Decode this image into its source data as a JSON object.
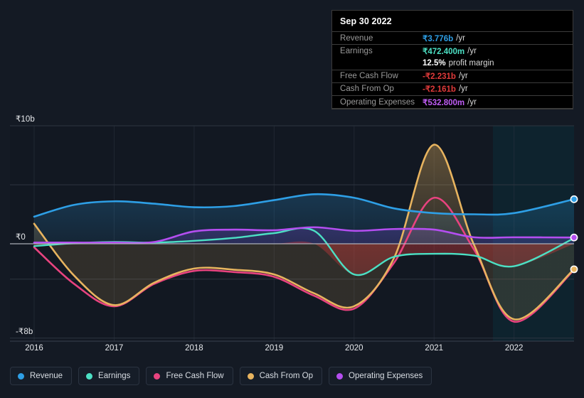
{
  "chart_data": {
    "type": "area",
    "title": "",
    "xlabel": "",
    "ylabel": "",
    "currency": "₹",
    "ylim": [
      -8,
      10
    ],
    "y_ticks": [
      {
        "label": "₹10b",
        "value": 10
      },
      {
        "label": "₹0",
        "value": 0
      },
      {
        "label": "-₹8b",
        "value": -8
      }
    ],
    "x_ticks": [
      "2016",
      "2017",
      "2018",
      "2019",
      "2020",
      "2021",
      "2022"
    ],
    "grid": true,
    "legend_position": "bottom",
    "forecast_band_start": "2022",
    "series": [
      {
        "name": "Revenue",
        "color": "#2e9fe6",
        "x": [
          2016.0,
          2016.5,
          2017.0,
          2017.5,
          2018.0,
          2018.5,
          2019.0,
          2019.5,
          2020.0,
          2020.5,
          2021.0,
          2021.5,
          2022.0,
          2022.75
        ],
        "values": [
          2.3,
          3.3,
          3.6,
          3.4,
          3.1,
          3.2,
          3.7,
          4.2,
          3.9,
          3.0,
          2.6,
          2.5,
          2.6,
          3.776
        ]
      },
      {
        "name": "Earnings",
        "color": "#4ce0c4",
        "x": [
          2016.0,
          2016.5,
          2017.0,
          2017.5,
          2018.0,
          2018.5,
          2019.0,
          2019.5,
          2020.0,
          2020.5,
          2021.0,
          2021.5,
          2022.0,
          2022.75
        ],
        "values": [
          -0.2,
          0.05,
          0.15,
          0.1,
          0.25,
          0.5,
          0.9,
          1.1,
          -2.6,
          -1.1,
          -0.85,
          -1.0,
          -1.9,
          0.4724
        ]
      },
      {
        "name": "Free Cash Flow",
        "color": "#e8437f",
        "x": [
          2016.0,
          2016.5,
          2017.0,
          2017.5,
          2018.0,
          2018.5,
          2019.0,
          2019.5,
          2020.0,
          2020.5,
          2021.0,
          2021.5,
          2022.0,
          2022.75
        ],
        "values": [
          -0.3,
          -3.4,
          -5.3,
          -3.4,
          -2.3,
          -2.4,
          -2.8,
          -4.4,
          -5.5,
          -1.6,
          3.9,
          -0.5,
          -6.6,
          -2.231
        ]
      },
      {
        "name": "Cash From Op",
        "color": "#e8b45f",
        "x": [
          2016.0,
          2016.5,
          2017.0,
          2017.5,
          2018.0,
          2018.5,
          2019.0,
          2019.5,
          2020.0,
          2020.5,
          2021.0,
          2021.5,
          2022.0,
          2022.75
        ],
        "values": [
          1.7,
          -2.7,
          -5.2,
          -3.3,
          -2.1,
          -2.2,
          -2.6,
          -4.2,
          -5.3,
          -1.2,
          8.4,
          -0.1,
          -6.4,
          -2.161
        ]
      },
      {
        "name": "Operating Expenses",
        "color": "#b44ef0",
        "x": [
          2016.0,
          2016.5,
          2017.0,
          2017.5,
          2018.0,
          2018.5,
          2019.0,
          2019.5,
          2020.0,
          2020.5,
          2021.0,
          2021.5,
          2022.0,
          2022.75
        ],
        "values": [
          0.1,
          0.1,
          0.1,
          0.15,
          1.05,
          1.2,
          1.15,
          1.4,
          1.1,
          1.25,
          1.2,
          0.55,
          0.55,
          0.5328
        ]
      }
    ]
  },
  "tooltip": {
    "date": "Sep 30 2022",
    "rows": [
      {
        "name": "Revenue",
        "value": "₹3.776b",
        "unit": "/yr",
        "color": "#2e9fe6"
      },
      {
        "name": "Earnings",
        "value": "₹472.400m",
        "unit": "/yr",
        "color": "#4ce0c4"
      },
      {
        "name": "Free Cash Flow",
        "value": "-₹2.231b",
        "unit": "/yr",
        "color": "#e03a3a"
      },
      {
        "name": "Cash From Op",
        "value": "-₹2.161b",
        "unit": "/yr",
        "color": "#e03a3a"
      },
      {
        "name": "Operating Expenses",
        "value": "₹532.800m",
        "unit": "/yr",
        "color": "#c05ef5"
      }
    ],
    "margin_value": "12.5%",
    "margin_label": "profit margin"
  },
  "legend": {
    "items": [
      {
        "label": "Revenue",
        "color": "#2e9fe6"
      },
      {
        "label": "Earnings",
        "color": "#4ce0c4"
      },
      {
        "label": "Free Cash Flow",
        "color": "#e8437f"
      },
      {
        "label": "Cash From Op",
        "color": "#e8b45f"
      },
      {
        "label": "Operating Expenses",
        "color": "#b44ef0"
      }
    ]
  },
  "colors": {
    "background": "#141a24",
    "plot_background": "#121822",
    "forecast_band": "#0e2630",
    "grid": "#2d3540",
    "zero_line": "#b9bec6",
    "axis_text": "#e8eaed"
  }
}
